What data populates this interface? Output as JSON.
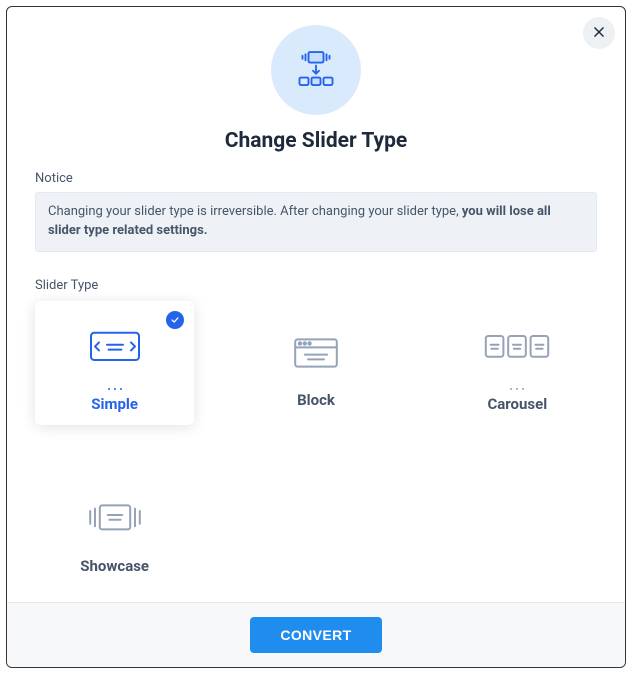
{
  "header": {
    "title": "Change Slider Type"
  },
  "notice": {
    "label": "Notice",
    "text_normal": "Changing your slider type is irreversible. After changing your slider type, ",
    "text_bold": "you will lose all slider type related settings."
  },
  "slider_type": {
    "label": "Slider Type",
    "options": {
      "simple": {
        "label": "Simple",
        "selected": true
      },
      "block": {
        "label": "Block",
        "selected": false
      },
      "carousel": {
        "label": "Carousel",
        "selected": false
      },
      "showcase": {
        "label": "Showcase",
        "selected": false
      }
    }
  },
  "footer": {
    "convert_label": "CONVERT"
  },
  "colors": {
    "accent": "#2563eb",
    "muted": "#94a3b8"
  }
}
